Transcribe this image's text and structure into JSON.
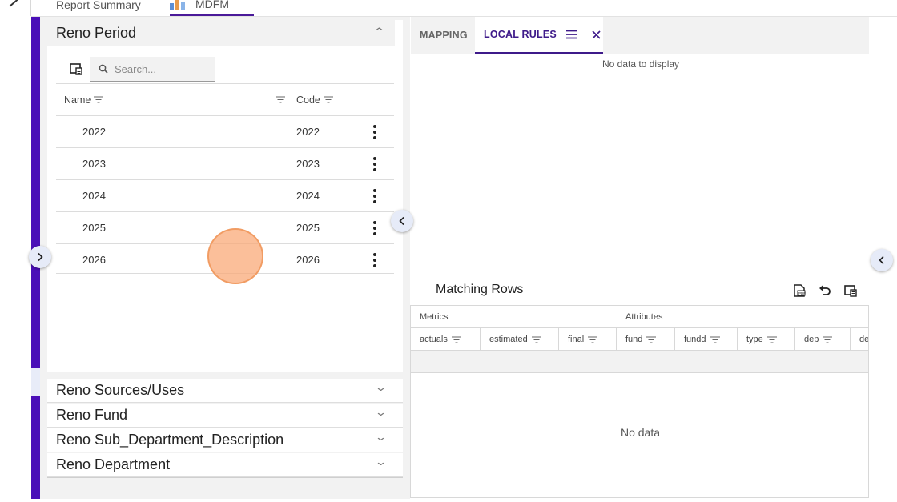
{
  "top_tabs": [
    {
      "label": "Report Summary"
    },
    {
      "label": "MDFM"
    }
  ],
  "period_panel": {
    "title": "Reno Period",
    "search_placeholder": "Search...",
    "columns": {
      "name": "Name",
      "code": "Code"
    },
    "rows": [
      {
        "name": "2022",
        "code": "2022"
      },
      {
        "name": "2023",
        "code": "2023"
      },
      {
        "name": "2024",
        "code": "2024"
      },
      {
        "name": "2025",
        "code": "2025"
      },
      {
        "name": "2026",
        "code": "2026"
      }
    ]
  },
  "sections": [
    {
      "title": "Reno Sources/Uses"
    },
    {
      "title": "Reno Fund"
    },
    {
      "title": "Reno Sub_Department_Description"
    },
    {
      "title": "Reno Department"
    }
  ],
  "right_panel": {
    "tabs": [
      {
        "label": "MAPPING"
      },
      {
        "label": "LOCAL RULES"
      }
    ],
    "rules_empty_text": "No data to display",
    "matching_rows": {
      "title": "Matching Rows",
      "groups": {
        "metrics": "Metrics",
        "attributes": "Attributes"
      },
      "columns": [
        "actuals",
        "estimated",
        "final",
        "fund",
        "fundd",
        "type",
        "dep",
        "de"
      ],
      "empty_text": "No data"
    }
  },
  "colors": {
    "accent": "#4a0fb8",
    "tab_active": "#3e1a8a",
    "click_marker": "#f7a46b"
  },
  "icons": [
    "export-icon",
    "search-icon",
    "filter-icon",
    "kebab-menu-icon",
    "chevron-up-icon",
    "chevron-down-icon",
    "chevron-left-icon",
    "chevron-right-icon",
    "menu-icon",
    "close-icon",
    "pdf-export-icon",
    "undo-icon"
  ]
}
